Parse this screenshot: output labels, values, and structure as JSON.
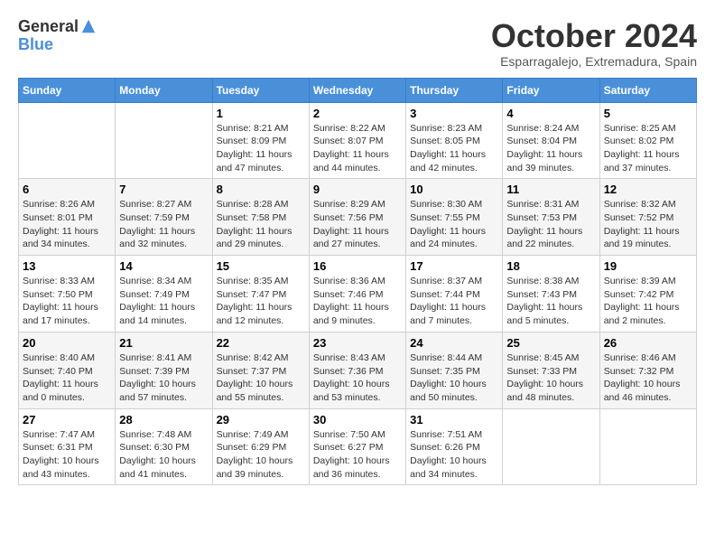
{
  "header": {
    "logo_general": "General",
    "logo_blue": "Blue",
    "month_title": "October 2024",
    "location": "Esparragalejo, Extremadura, Spain"
  },
  "weekdays": [
    "Sunday",
    "Monday",
    "Tuesday",
    "Wednesday",
    "Thursday",
    "Friday",
    "Saturday"
  ],
  "weeks": [
    [
      {
        "day": "",
        "info": ""
      },
      {
        "day": "",
        "info": ""
      },
      {
        "day": "1",
        "info": "Sunrise: 8:21 AM\nSunset: 8:09 PM\nDaylight: 11 hours and 47 minutes."
      },
      {
        "day": "2",
        "info": "Sunrise: 8:22 AM\nSunset: 8:07 PM\nDaylight: 11 hours and 44 minutes."
      },
      {
        "day": "3",
        "info": "Sunrise: 8:23 AM\nSunset: 8:05 PM\nDaylight: 11 hours and 42 minutes."
      },
      {
        "day": "4",
        "info": "Sunrise: 8:24 AM\nSunset: 8:04 PM\nDaylight: 11 hours and 39 minutes."
      },
      {
        "day": "5",
        "info": "Sunrise: 8:25 AM\nSunset: 8:02 PM\nDaylight: 11 hours and 37 minutes."
      }
    ],
    [
      {
        "day": "6",
        "info": "Sunrise: 8:26 AM\nSunset: 8:01 PM\nDaylight: 11 hours and 34 minutes."
      },
      {
        "day": "7",
        "info": "Sunrise: 8:27 AM\nSunset: 7:59 PM\nDaylight: 11 hours and 32 minutes."
      },
      {
        "day": "8",
        "info": "Sunrise: 8:28 AM\nSunset: 7:58 PM\nDaylight: 11 hours and 29 minutes."
      },
      {
        "day": "9",
        "info": "Sunrise: 8:29 AM\nSunset: 7:56 PM\nDaylight: 11 hours and 27 minutes."
      },
      {
        "day": "10",
        "info": "Sunrise: 8:30 AM\nSunset: 7:55 PM\nDaylight: 11 hours and 24 minutes."
      },
      {
        "day": "11",
        "info": "Sunrise: 8:31 AM\nSunset: 7:53 PM\nDaylight: 11 hours and 22 minutes."
      },
      {
        "day": "12",
        "info": "Sunrise: 8:32 AM\nSunset: 7:52 PM\nDaylight: 11 hours and 19 minutes."
      }
    ],
    [
      {
        "day": "13",
        "info": "Sunrise: 8:33 AM\nSunset: 7:50 PM\nDaylight: 11 hours and 17 minutes."
      },
      {
        "day": "14",
        "info": "Sunrise: 8:34 AM\nSunset: 7:49 PM\nDaylight: 11 hours and 14 minutes."
      },
      {
        "day": "15",
        "info": "Sunrise: 8:35 AM\nSunset: 7:47 PM\nDaylight: 11 hours and 12 minutes."
      },
      {
        "day": "16",
        "info": "Sunrise: 8:36 AM\nSunset: 7:46 PM\nDaylight: 11 hours and 9 minutes."
      },
      {
        "day": "17",
        "info": "Sunrise: 8:37 AM\nSunset: 7:44 PM\nDaylight: 11 hours and 7 minutes."
      },
      {
        "day": "18",
        "info": "Sunrise: 8:38 AM\nSunset: 7:43 PM\nDaylight: 11 hours and 5 minutes."
      },
      {
        "day": "19",
        "info": "Sunrise: 8:39 AM\nSunset: 7:42 PM\nDaylight: 11 hours and 2 minutes."
      }
    ],
    [
      {
        "day": "20",
        "info": "Sunrise: 8:40 AM\nSunset: 7:40 PM\nDaylight: 11 hours and 0 minutes."
      },
      {
        "day": "21",
        "info": "Sunrise: 8:41 AM\nSunset: 7:39 PM\nDaylight: 10 hours and 57 minutes."
      },
      {
        "day": "22",
        "info": "Sunrise: 8:42 AM\nSunset: 7:37 PM\nDaylight: 10 hours and 55 minutes."
      },
      {
        "day": "23",
        "info": "Sunrise: 8:43 AM\nSunset: 7:36 PM\nDaylight: 10 hours and 53 minutes."
      },
      {
        "day": "24",
        "info": "Sunrise: 8:44 AM\nSunset: 7:35 PM\nDaylight: 10 hours and 50 minutes."
      },
      {
        "day": "25",
        "info": "Sunrise: 8:45 AM\nSunset: 7:33 PM\nDaylight: 10 hours and 48 minutes."
      },
      {
        "day": "26",
        "info": "Sunrise: 8:46 AM\nSunset: 7:32 PM\nDaylight: 10 hours and 46 minutes."
      }
    ],
    [
      {
        "day": "27",
        "info": "Sunrise: 7:47 AM\nSunset: 6:31 PM\nDaylight: 10 hours and 43 minutes."
      },
      {
        "day": "28",
        "info": "Sunrise: 7:48 AM\nSunset: 6:30 PM\nDaylight: 10 hours and 41 minutes."
      },
      {
        "day": "29",
        "info": "Sunrise: 7:49 AM\nSunset: 6:29 PM\nDaylight: 10 hours and 39 minutes."
      },
      {
        "day": "30",
        "info": "Sunrise: 7:50 AM\nSunset: 6:27 PM\nDaylight: 10 hours and 36 minutes."
      },
      {
        "day": "31",
        "info": "Sunrise: 7:51 AM\nSunset: 6:26 PM\nDaylight: 10 hours and 34 minutes."
      },
      {
        "day": "",
        "info": ""
      },
      {
        "day": "",
        "info": ""
      }
    ]
  ]
}
